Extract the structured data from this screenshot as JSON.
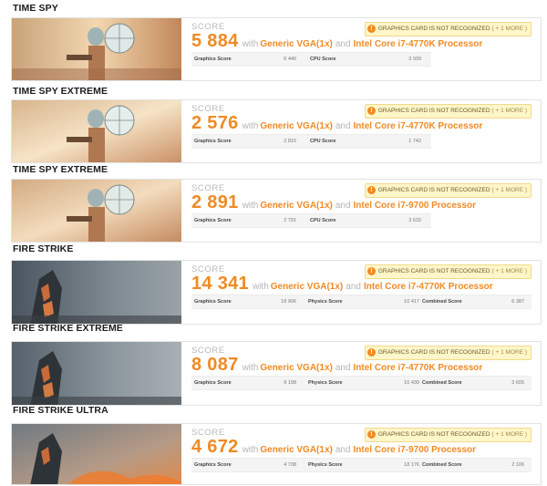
{
  "warning": {
    "text": "GRAPHICS CARD IS NOT RECOGNIZED",
    "more": "( + 1 MORE )"
  },
  "score_label": "SCORE",
  "with_text": "with",
  "and_text": "and",
  "benchmarks": [
    {
      "title": "TIME SPY",
      "score": "5 884",
      "gpu": "Generic VGA(1x)",
      "cpu": "Intel Core i7-4770K Processor",
      "subscores": [
        {
          "label": "Graphics Score",
          "value": "6 446"
        },
        {
          "label": "CPU Score",
          "value": "3 939"
        }
      ]
    },
    {
      "title": "TIME SPY EXTREME",
      "score": "2 576",
      "gpu": "Generic VGA(1x)",
      "cpu": "Intel Core i7-4770K Processor",
      "subscores": [
        {
          "label": "Graphics Score",
          "value": "2 815"
        },
        {
          "label": "CPU Score",
          "value": "1 742"
        }
      ]
    },
    {
      "title": "TIME SPY EXTREME",
      "score": "2 891",
      "gpu": "Generic VGA(1x)",
      "cpu": "Intel Core i7-9700 Processor",
      "subscores": [
        {
          "label": "Graphics Score",
          "value": "2 791"
        },
        {
          "label": "CPU Score",
          "value": "3 632"
        }
      ]
    },
    {
      "title": "FIRE STRIKE",
      "score": "14 341",
      "gpu": "Generic VGA(1x)",
      "cpu": "Intel Core i7-4770K Processor",
      "subscores": [
        {
          "label": "Graphics Score",
          "value": "18 906"
        },
        {
          "label": "Physics Score",
          "value": "10 417"
        },
        {
          "label": "Combined Score",
          "value": "6 387"
        }
      ]
    },
    {
      "title": "FIRE STRIKE EXTREME",
      "score": "8 087",
      "gpu": "Generic VGA(1x)",
      "cpu": "Intel Core i7-4770K Processor",
      "subscores": [
        {
          "label": "Graphics Score",
          "value": "9 198"
        },
        {
          "label": "Physics Score",
          "value": "10 439"
        },
        {
          "label": "Combined Score",
          "value": "3 605"
        }
      ]
    },
    {
      "title": "FIRE STRIKE ULTRA",
      "score": "4 672",
      "gpu": "Generic VGA(1x)",
      "cpu": "Intel Core i7-9700 Processor",
      "subscores": [
        {
          "label": "Graphics Score",
          "value": "4 738"
        },
        {
          "label": "Physics Score",
          "value": "18 176"
        },
        {
          "label": "Combined Score",
          "value": "2 106"
        }
      ]
    }
  ]
}
